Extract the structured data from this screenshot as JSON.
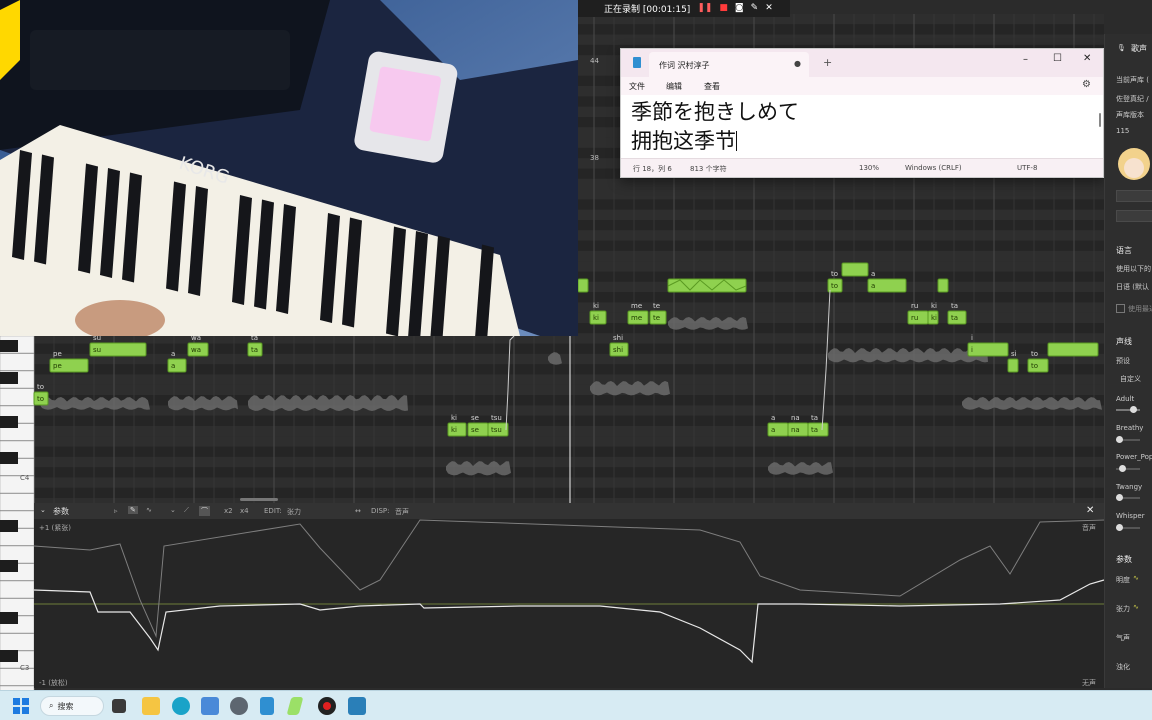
{
  "recorder": {
    "status": "正在录制 [00:01:15]"
  },
  "notepad": {
    "tab_title": "作词 沢村淳子",
    "menu": [
      "文件",
      "编辑",
      "查看"
    ],
    "lines": [
      "季節を抱きしめて",
      "拥抱这季节"
    ],
    "status": {
      "position": "行 18，列 6",
      "chars": "813 个字符",
      "zoom": "130%",
      "eol": "Windows (CRLF)",
      "encoding": "UTF-8"
    }
  },
  "piano_roll": {
    "measure_labels": [
      "44",
      "38"
    ],
    "octave_labels": [
      "C4",
      "C3"
    ],
    "notes": [
      {
        "lyric": "to",
        "label": "to"
      },
      {
        "lyric": "pe",
        "label": "pe"
      },
      {
        "lyric": "su",
        "label": "su"
      },
      {
        "lyric": "a",
        "label": "a"
      },
      {
        "lyric": "wa",
        "label": "wa"
      },
      {
        "lyric": "ta",
        "label": "ta"
      },
      {
        "lyric": "ki",
        "label": "ki"
      },
      {
        "lyric": "se",
        "label": "se"
      },
      {
        "lyric": "tsu",
        "label": "tsu"
      },
      {
        "lyric": "ki",
        "label": "ki"
      },
      {
        "lyric": "me",
        "label": "me"
      },
      {
        "lyric": "te",
        "label": "te"
      },
      {
        "lyric": "shi",
        "label": "shi"
      },
      {
        "lyric": "a",
        "label": "a"
      },
      {
        "lyric": "na",
        "label": "na"
      },
      {
        "lyric": "ta",
        "label": "ta"
      },
      {
        "lyric": "to",
        "label": "to"
      },
      {
        "lyric": "a",
        "label": "a"
      },
      {
        "lyric": "ru",
        "label": "ru"
      },
      {
        "lyric": "ki",
        "label": "ki"
      },
      {
        "lyric": "ta",
        "label": "ta"
      },
      {
        "lyric": "i",
        "label": "i"
      },
      {
        "lyric": "",
        "label": "si"
      },
      {
        "lyric": "to",
        "label": "to"
      }
    ]
  },
  "param_panel": {
    "title": "参数",
    "edit_label": "EDIT:",
    "edit_value": "张力",
    "disp_label": "DISP:",
    "disp_value": "音声",
    "top_left": "+1 (紧张)",
    "bottom_left": "-1 (放松)",
    "top_right": "音声",
    "bottom_right": "无声",
    "mode_labels": [
      "x2",
      "x4"
    ]
  },
  "right_panel": {
    "singer_header": "歌声",
    "current_voice_label": "当前声库 (",
    "voice_value": "佐登真纪 /",
    "voice_version_label": "声库版本",
    "voice_version_value": "115",
    "language_header": "语言",
    "use_following_label": "使用以下的",
    "language_value": "日语 (默认",
    "use_recent_label": "使用最近",
    "voice_timbre_header": "声线",
    "preset_label": "预设",
    "preset_value": "自定义",
    "sliders": [
      "Adult",
      "Breathy",
      "Power_Pop",
      "Twangy",
      "Whisper"
    ],
    "param_header": "参数",
    "params": [
      "明度",
      "张力",
      "气声",
      "浊化"
    ]
  },
  "taskbar": {
    "search_label": "搜索"
  },
  "colors": {
    "note_fill": "#8fd14f",
    "note_border": "#5a9a22",
    "pitch_line": "#e8e8e8",
    "background": "#2b2b2b"
  }
}
